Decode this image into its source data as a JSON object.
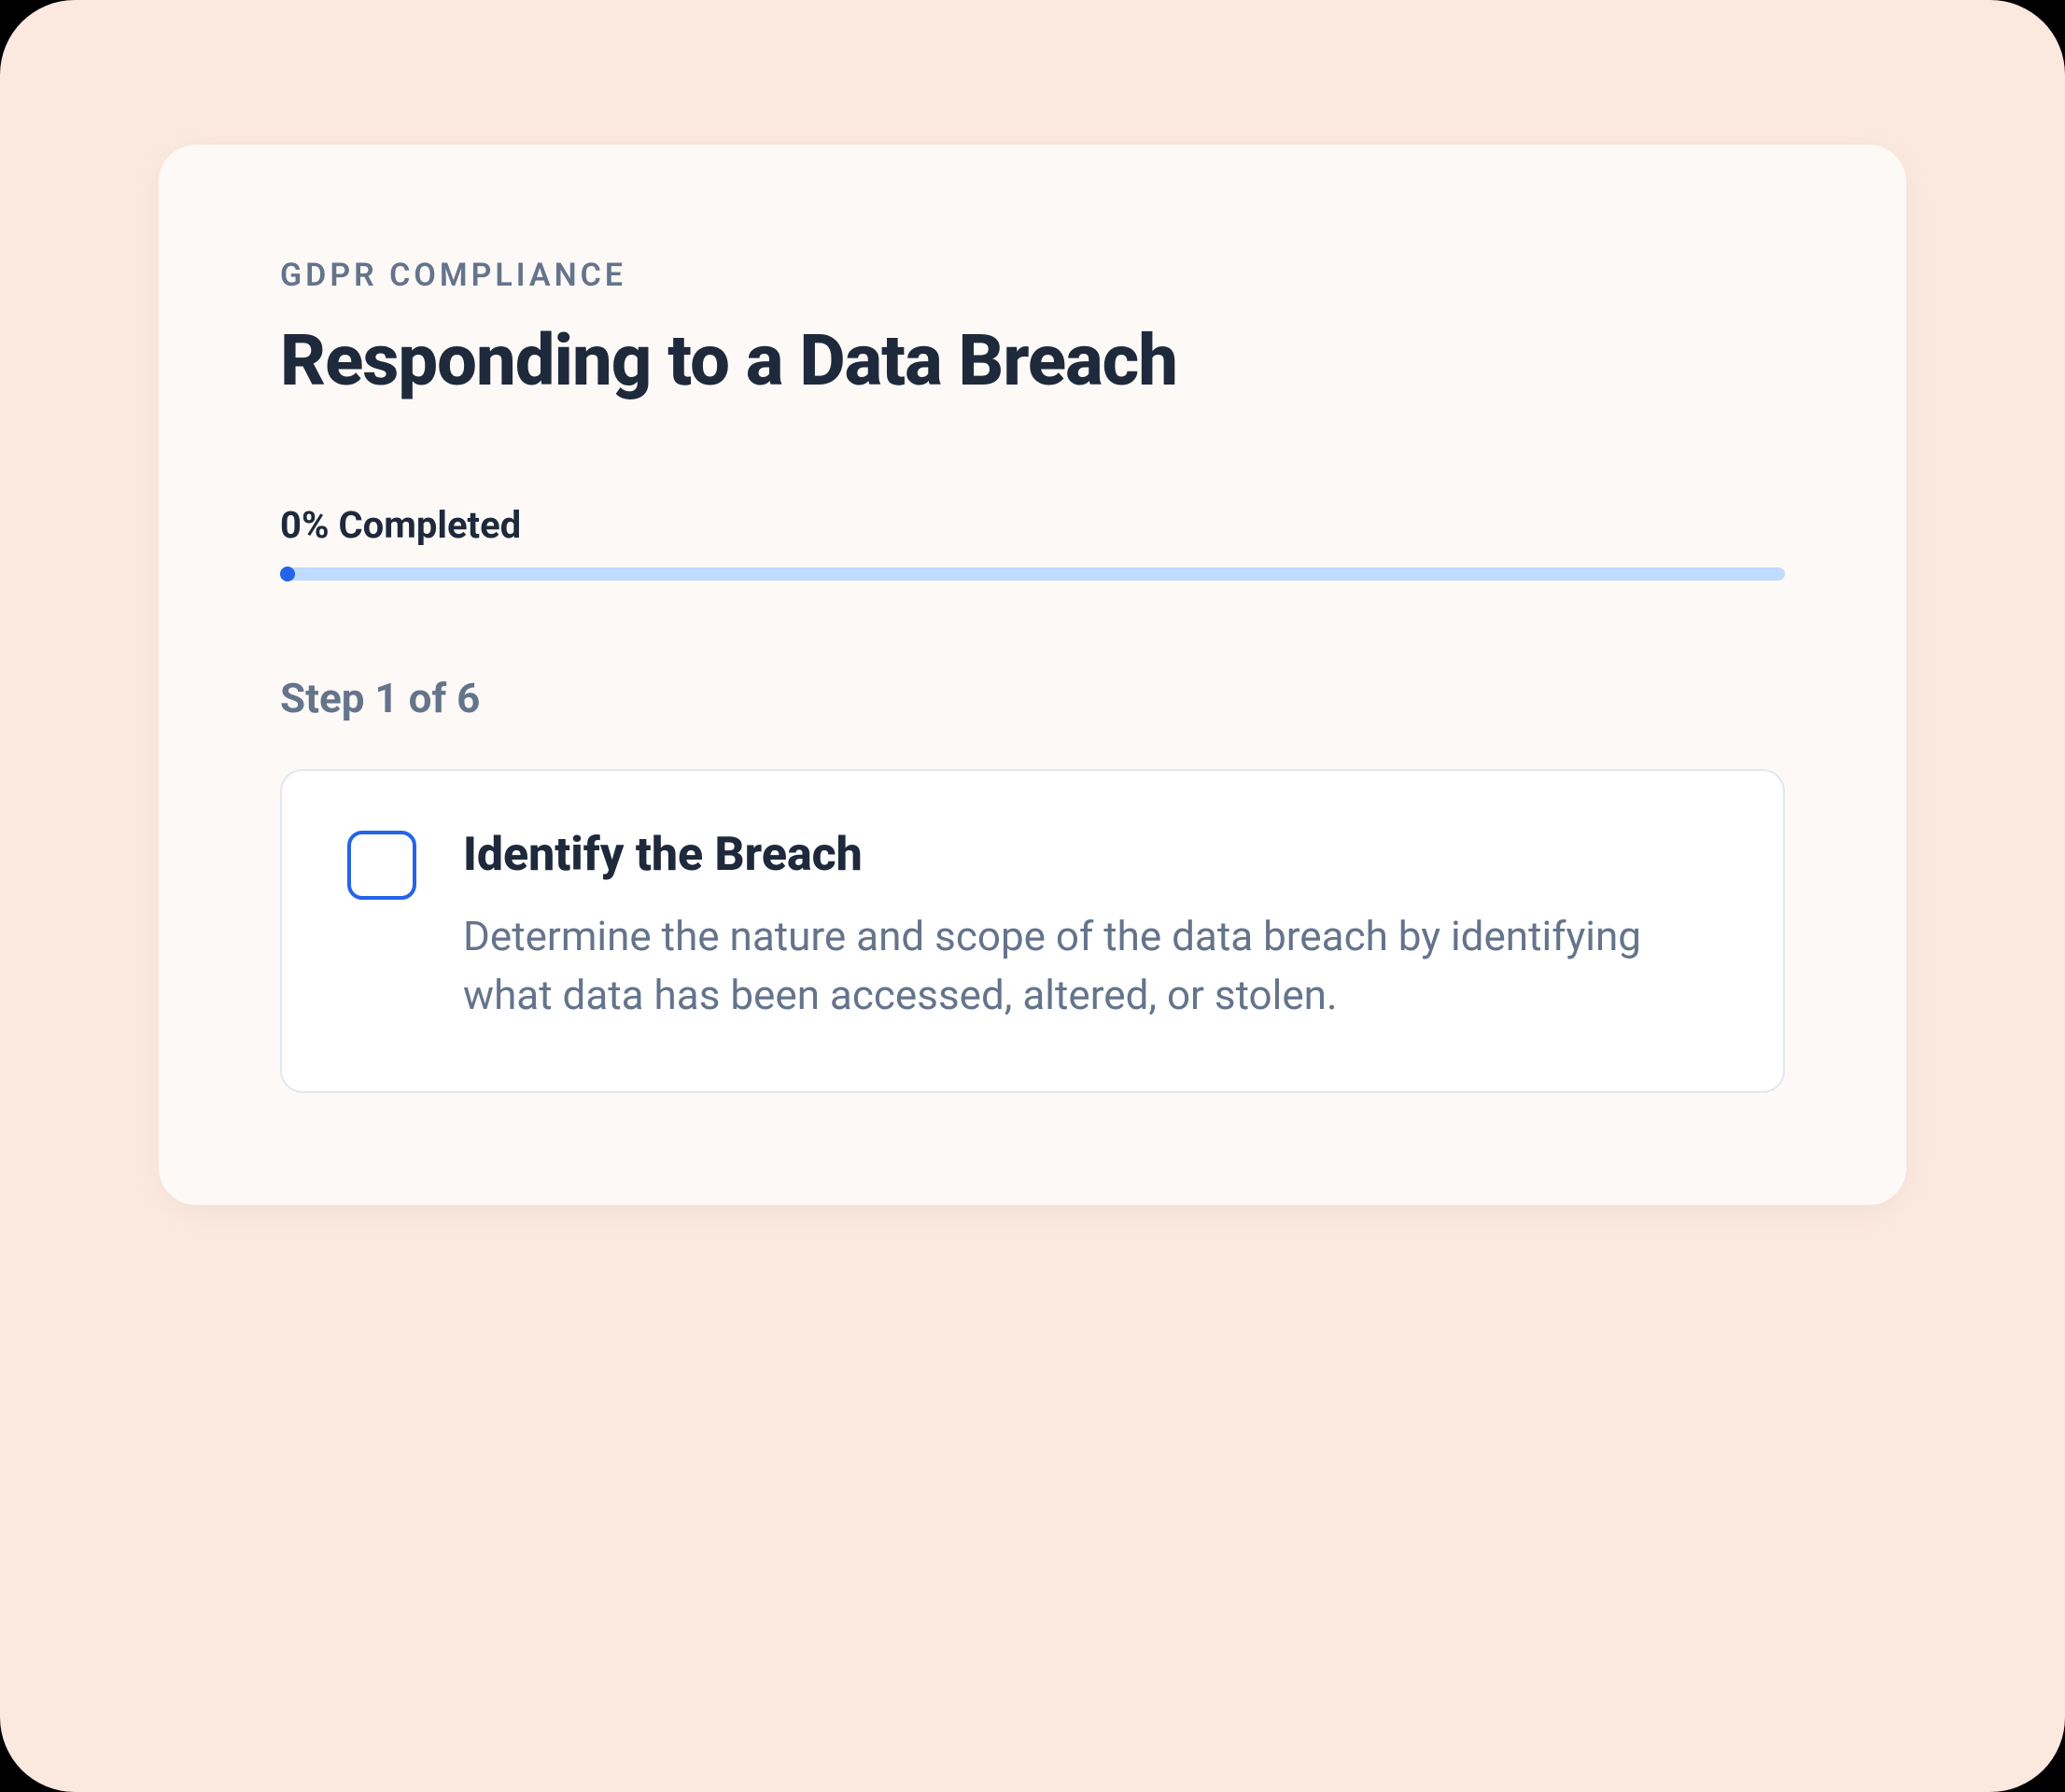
{
  "eyebrow": "GDPR COMPLIANCE",
  "title": "Responding to a Data Breach",
  "progress": {
    "label": "0% Completed",
    "percent": 0
  },
  "step": {
    "indicator": "Step 1 of 6",
    "title": "Identify the Breach",
    "description": "Determine the nature and scope of the data breach by identifying what data has been accessed, altered, or stolen.",
    "checked": false
  }
}
